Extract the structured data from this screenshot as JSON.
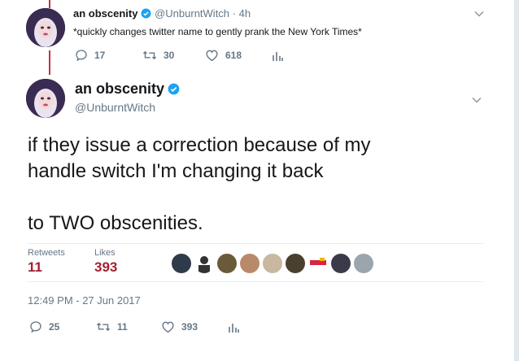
{
  "reply_tweet": {
    "name": "an obscenity",
    "handle": "@UnburntWitch",
    "time": "4h",
    "separator": "·",
    "text": "*quickly changes twitter name to gently prank the New York Times*",
    "replies": "17",
    "retweets": "30",
    "likes": "618"
  },
  "main_tweet": {
    "name": "an obscenity",
    "handle": "@UnburntWitch",
    "text_line1": "if they issue a correction because of my",
    "text_line2": "handle switch I'm changing it back",
    "text_line3": "to TWO obscenities.",
    "retweets_label": "Retweets",
    "retweets_count": "11",
    "likes_label": "Likes",
    "likes_count": "393",
    "timestamp": "12:49 PM - 27 Jun 2017",
    "replies": "25",
    "action_retweets": "11",
    "action_likes": "393"
  },
  "colors": {
    "verified": "#1da1f2",
    "count": "#14171a",
    "muted": "#657786"
  },
  "icons": [
    "reply-icon",
    "retweet-icon",
    "heart-icon",
    "analytics-icon",
    "chevron-down-icon",
    "verified-badge-icon"
  ]
}
